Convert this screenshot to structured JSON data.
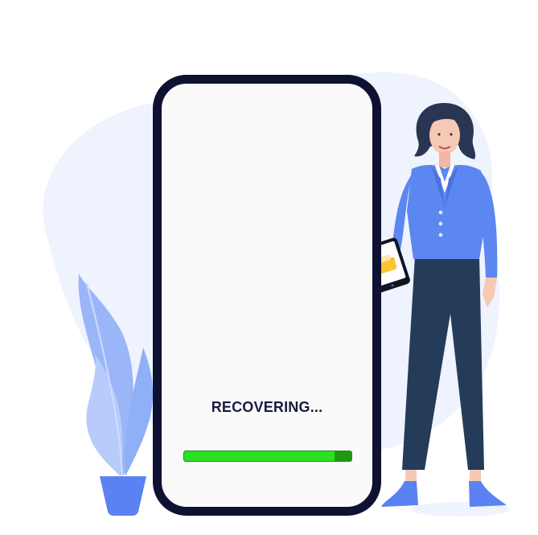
{
  "status": {
    "text": "RECOVERING..."
  },
  "progress": {
    "fraction": 0.9
  },
  "colors": {
    "phone_frame": "#0f1132",
    "progress_fill": "#29e11f",
    "progress_track": "#1e9a12",
    "jacket": "#5c86f0",
    "pants": "#253b5a",
    "plant": "#8fb0f7",
    "pot": "#5a82f2",
    "background_blob": "#eef3fd"
  },
  "illustration": {
    "figure": "woman-holding-tablet",
    "tablet_icon": "folder-icon",
    "decor": "potted-plant"
  }
}
